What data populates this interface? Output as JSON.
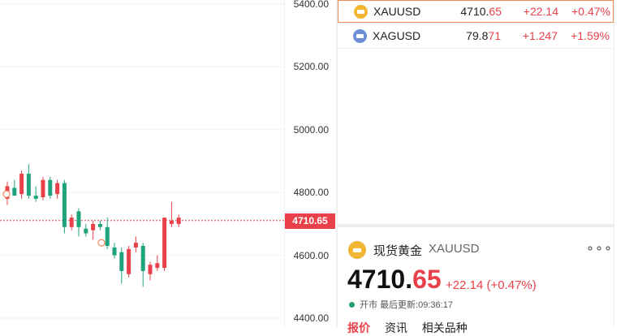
{
  "chart": {
    "y_ticks": [
      "5400.00",
      "5200.00",
      "5000.00",
      "4800.00",
      "4600.00",
      "4400.00"
    ],
    "current_price_label": "4710.65",
    "up_color": "#e8414a",
    "down_color": "#1fa37c",
    "candles": [
      {
        "o": 4780,
        "h": 4835,
        "l": 4760,
        "c": 4820
      },
      {
        "o": 4815,
        "h": 4840,
        "l": 4790,
        "c": 4790
      },
      {
        "o": 4795,
        "h": 4870,
        "l": 4780,
        "c": 4860
      },
      {
        "o": 4860,
        "h": 4890,
        "l": 4780,
        "c": 4790
      },
      {
        "o": 4790,
        "h": 4820,
        "l": 4770,
        "c": 4780
      },
      {
        "o": 4785,
        "h": 4850,
        "l": 4775,
        "c": 4840
      },
      {
        "o": 4840,
        "h": 4850,
        "l": 4780,
        "c": 4790
      },
      {
        "o": 4795,
        "h": 4840,
        "l": 4780,
        "c": 4830
      },
      {
        "o": 4830,
        "h": 4840,
        "l": 4670,
        "c": 4690
      },
      {
        "o": 4690,
        "h": 4730,
        "l": 4680,
        "c": 4720
      },
      {
        "o": 4740,
        "h": 4750,
        "l": 4660,
        "c": 4690
      },
      {
        "o": 4685,
        "h": 4700,
        "l": 4660,
        "c": 4670
      },
      {
        "o": 4680,
        "h": 4710,
        "l": 4650,
        "c": 4700
      },
      {
        "o": 4700,
        "h": 4710,
        "l": 4680,
        "c": 4690
      },
      {
        "o": 4690,
        "h": 4720,
        "l": 4620,
        "c": 4630
      },
      {
        "o": 4625,
        "h": 4640,
        "l": 4590,
        "c": 4600
      },
      {
        "o": 4610,
        "h": 4625,
        "l": 4510,
        "c": 4550
      },
      {
        "o": 4540,
        "h": 4630,
        "l": 4530,
        "c": 4620
      },
      {
        "o": 4625,
        "h": 4660,
        "l": 4610,
        "c": 4640
      },
      {
        "o": 4630,
        "h": 4640,
        "l": 4500,
        "c": 4550
      },
      {
        "o": 4540,
        "h": 4580,
        "l": 4520,
        "c": 4570
      },
      {
        "o": 4560,
        "h": 4600,
        "l": 4550,
        "c": 4575
      },
      {
        "o": 4560,
        "h": 4720,
        "l": 4550,
        "c": 4720
      },
      {
        "o": 4700,
        "h": 4770,
        "l": 4690,
        "c": 4710
      },
      {
        "o": 4700,
        "h": 4730,
        "l": 4690,
        "c": 4720
      }
    ]
  },
  "watchlist": [
    {
      "symbol": "XAUUSD",
      "price_main": "4710.",
      "price_tail": "65",
      "change": "+22.14",
      "pct": "+0.47%",
      "selected": true
    },
    {
      "symbol": "XAGUSD",
      "price_main": "79.8",
      "price_tail": "71",
      "change": "+1.247",
      "pct": "+1.59%",
      "selected": false
    }
  ],
  "detail": {
    "name": "现货黄金",
    "symbol": "XAUUSD",
    "more": "∘∘∘",
    "price_main": "4710.",
    "price_tail": "65",
    "change": "+22.14 (+0.47%)",
    "status": "开市",
    "updated": "最后更新:09:36:17",
    "tabs": [
      "报价",
      "资讯",
      "相关品种"
    ]
  }
}
